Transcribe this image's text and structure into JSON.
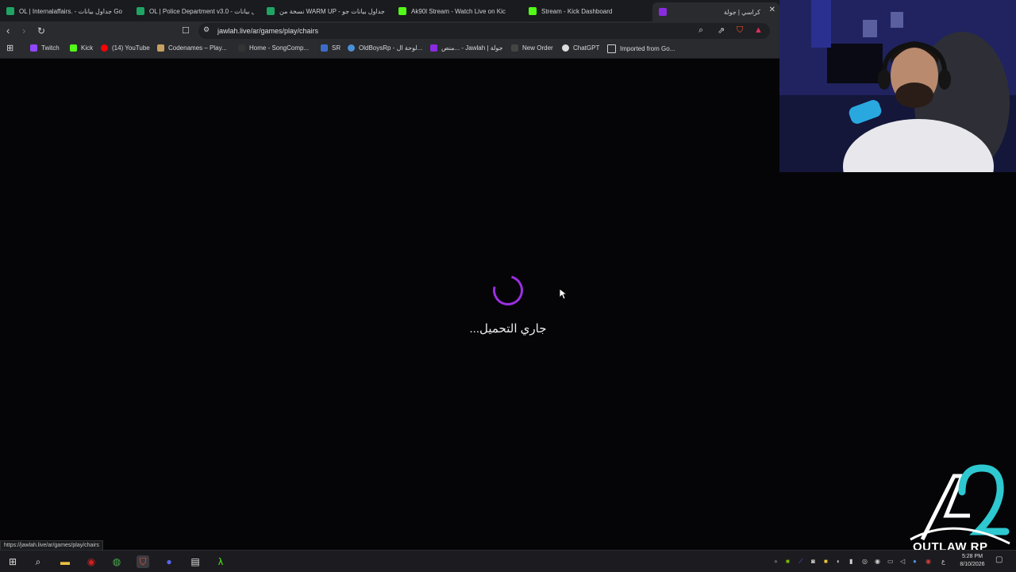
{
  "tabs": [
    {
      "label": "OL | Internalaffairs. - جداول بيانات Go",
      "icon": "sheets-icon",
      "color": "#1fa463"
    },
    {
      "label": "OL | Police Department v3.0 - جداول بيانات",
      "icon": "sheets-icon",
      "color": "#1fa463"
    },
    {
      "label": "نسخة من WARM UP - جداول بيانات جو",
      "icon": "sheets-icon",
      "color": "#1fa463"
    },
    {
      "label": "Ak90l Stream - Watch Live on Kic",
      "icon": "kick-icon",
      "color": "#53fc18"
    },
    {
      "label": "Stream - Kick Dashboard",
      "icon": "kick-icon",
      "color": "#53fc18"
    },
    {
      "label": "كراسي | جولة",
      "icon": "jawlah-icon",
      "color": "#8a2be2"
    }
  ],
  "toolbar": {
    "url": "jawlah.live/ar/games/play/chairs"
  },
  "bookmarks": [
    {
      "label": "Twitch",
      "icon": "twitch-icon",
      "color": "#9146ff"
    },
    {
      "label": "Kick",
      "icon": "kick-icon",
      "color": "#53fc18"
    },
    {
      "label": "(14) YouTube",
      "icon": "youtube-icon",
      "color": "#ff0000"
    },
    {
      "label": "Codenames – Play...",
      "icon": "codenames-icon",
      "color": "#c8a060"
    },
    {
      "label": "Home - SongComp...",
      "icon": "songcomp-icon",
      "color": "#333333"
    },
    {
      "label": "SR",
      "icon": "sr-icon",
      "color": "#3b6cc8"
    },
    {
      "label": "OldBoysRp - لوحة ال...",
      "icon": "oldboys-icon",
      "color": "#4a90d9"
    },
    {
      "label": "منص... - Jawlah | جولة",
      "icon": "jawlah-icon",
      "color": "#8a2be2"
    },
    {
      "label": "New Order",
      "icon": "neworder-icon",
      "color": "#444444"
    },
    {
      "label": "ChatGPT",
      "icon": "chatgpt-icon",
      "color": "#dddddd"
    },
    {
      "label": "Imported from Go...",
      "icon": "folder-icon",
      "color": "#cfcfcf"
    }
  ],
  "page": {
    "loading_text": "جاري التحميل...",
    "accent": "#9b2fe0"
  },
  "status_bar": {
    "url": "https://jawlah.live/ar/games/play/chairs"
  },
  "overlay": {
    "logo_text": "OUTLAW RP",
    "logo_color": "#2ec8d0"
  },
  "clock": {
    "time": "5:28 PM",
    "date": "8/10/2026"
  },
  "tray": {
    "lang": "ع"
  }
}
